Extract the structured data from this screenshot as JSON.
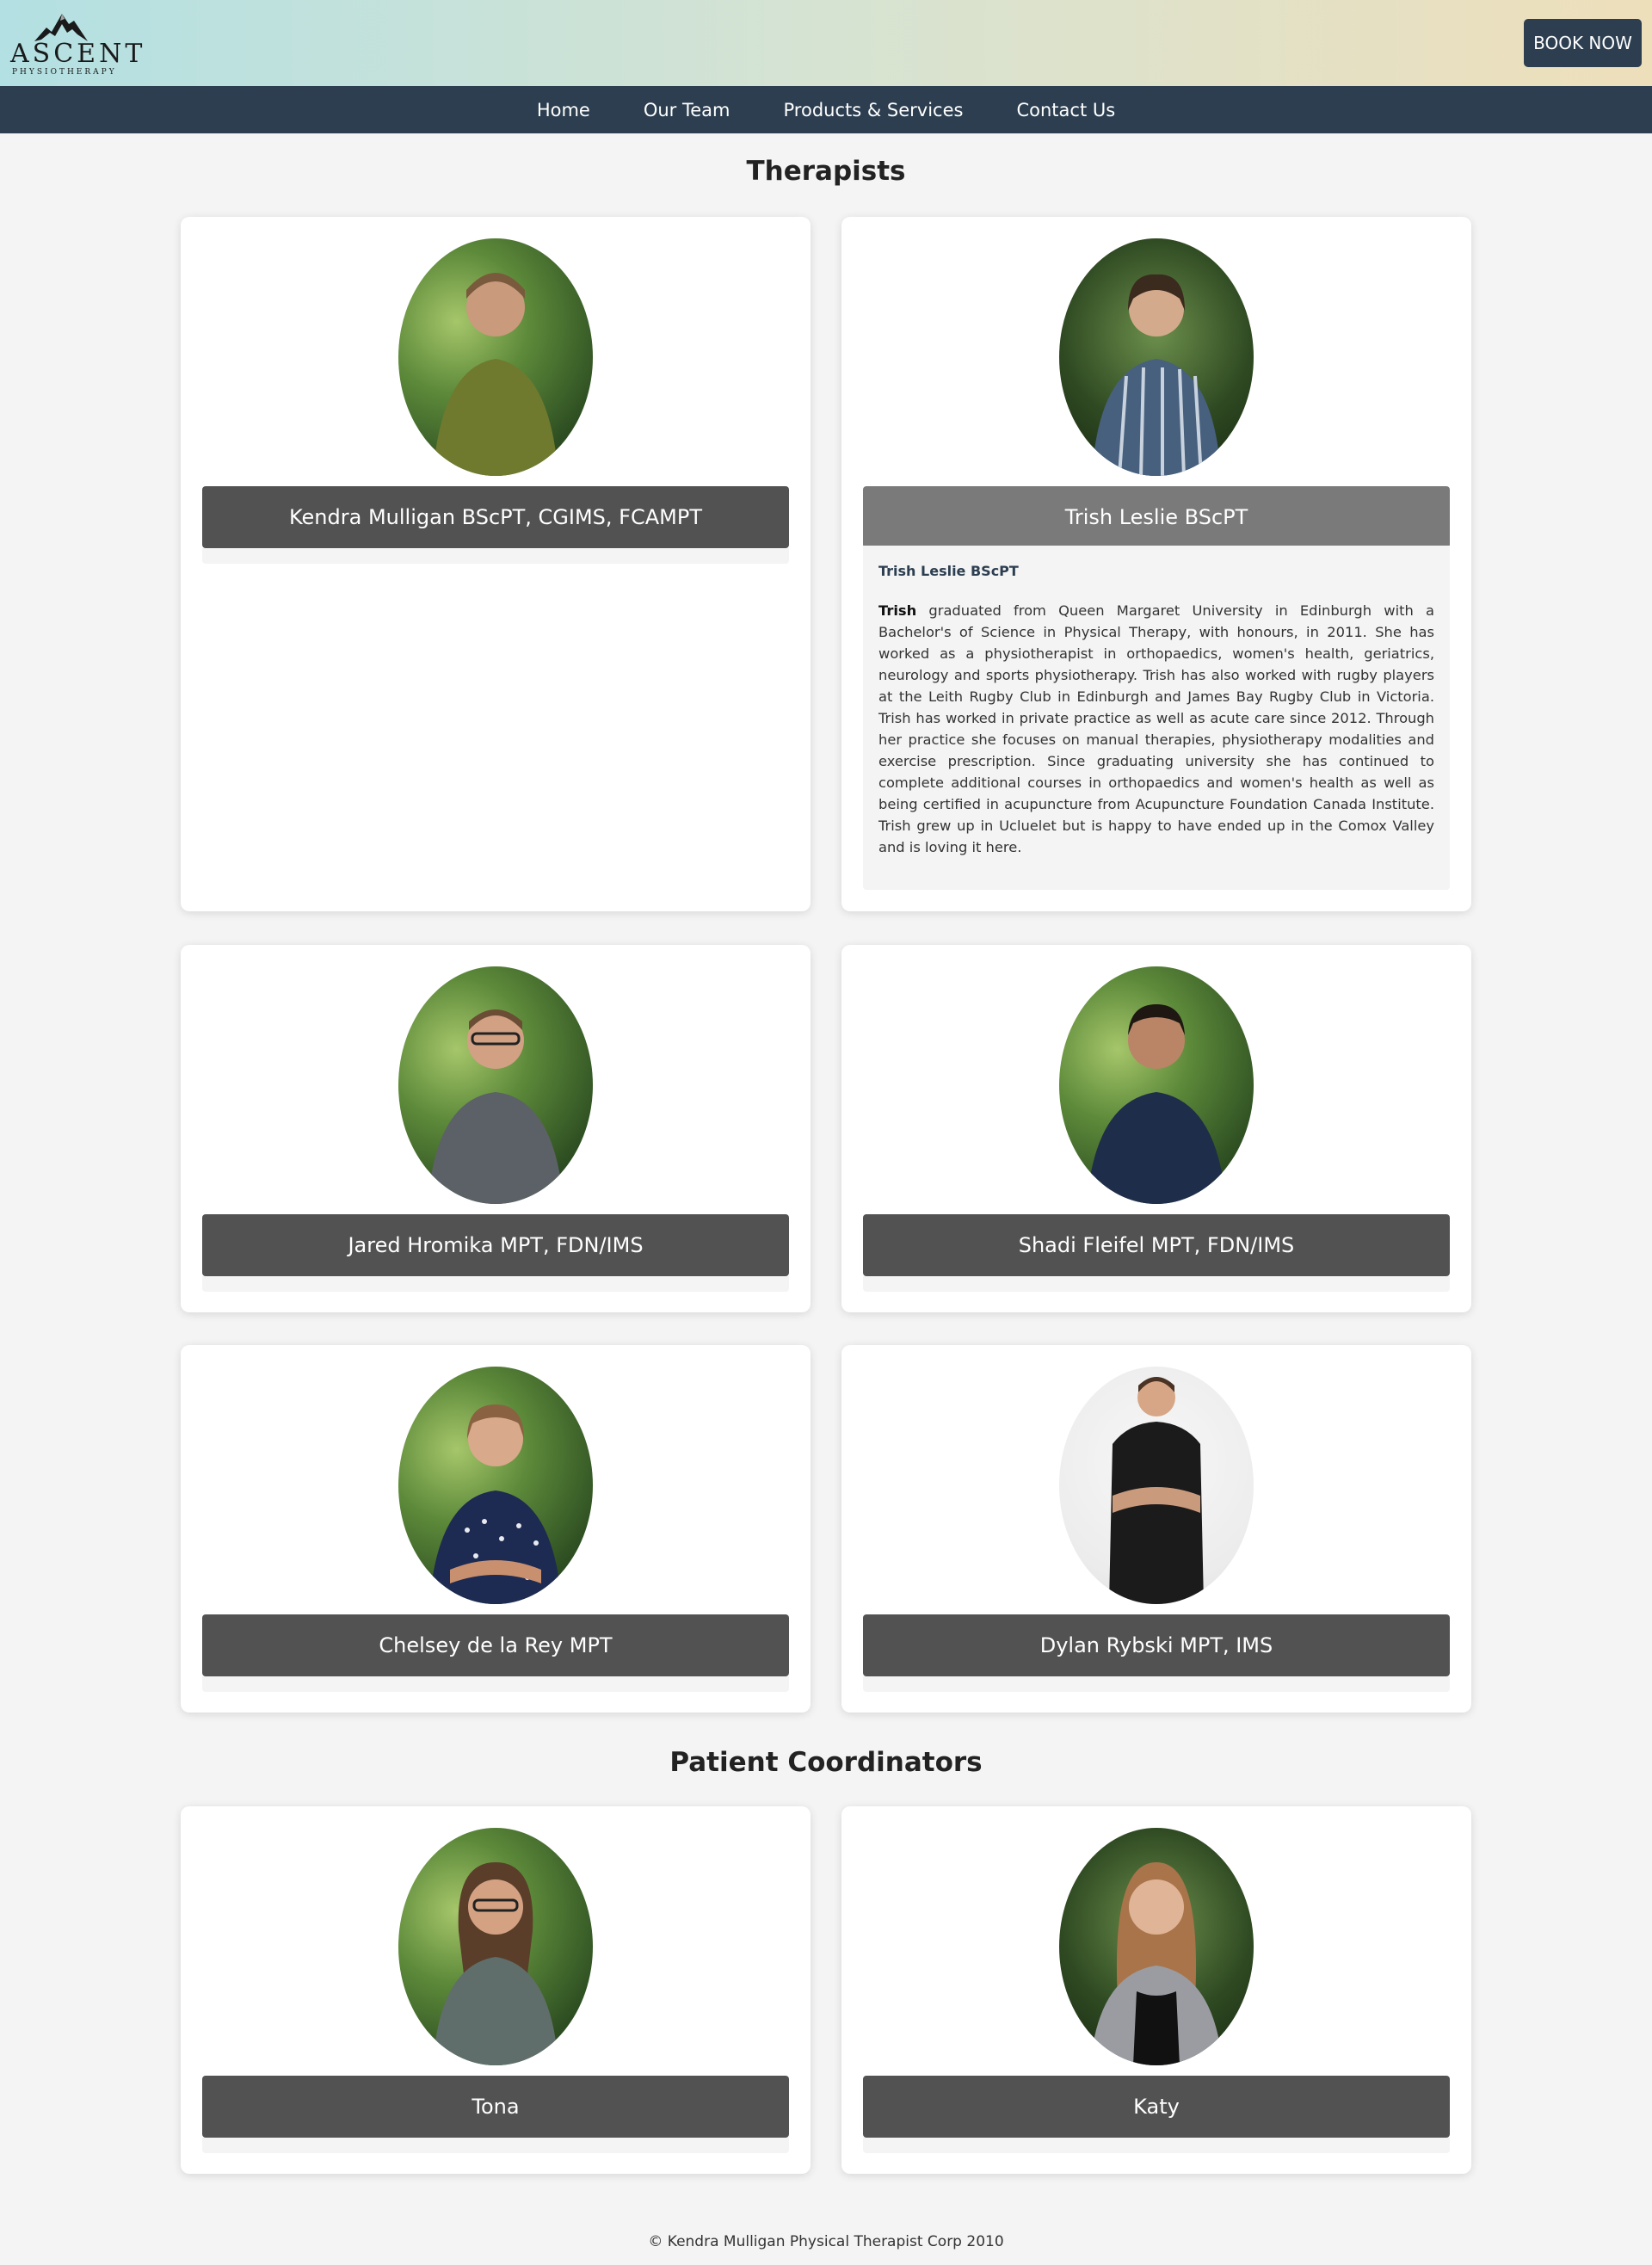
{
  "header": {
    "logo_text": "ASCENT",
    "logo_subtext": "PHYSIOTHERAPY",
    "book_button": "BOOK NOW"
  },
  "nav": {
    "items": [
      "Home",
      "Our Team",
      "Products & Services",
      "Contact Us"
    ]
  },
  "therapists": {
    "title": "Therapists",
    "members": [
      {
        "name": "Kendra Mulligan BScPT, CGIMS, FCAMPT"
      },
      {
        "name": "Trish Leslie BScPT",
        "bio_title": "Trish Leslie BScPT",
        "bio_first_word": "Trish",
        "bio_body": " graduated from Queen Margaret University in Edinburgh with a Bachelor's of Science in Physical Therapy, with honours, in 2011. She has worked as a physiotherapist in orthopaedics, women's health, geriatrics, neurology and sports physiotherapy. Trish has also worked with rugby players at the Leith Rugby Club in Edinburgh and James Bay Rugby Club in Victoria. Trish has worked in private practice as well as acute care since 2012. Through her practice she focuses on manual therapies, physiotherapy modalities and exercise prescription. Since graduating university she has continued to complete additional courses in orthopaedics and women's health as well as being certified in acupuncture from Acupuncture Foundation Canada Institute. Trish grew up in Ucluelet but is happy to have ended up in the Comox Valley and is loving it here."
      },
      {
        "name": "Jared Hromika MPT, FDN/IMS"
      },
      {
        "name": "Shadi Fleifel MPT, FDN/IMS"
      },
      {
        "name": "Chelsey de la Rey MPT"
      },
      {
        "name": "Dylan Rybski MPT, IMS"
      }
    ]
  },
  "coordinators": {
    "title": "Patient Coordinators",
    "members": [
      {
        "name": "Tona"
      },
      {
        "name": "Katy"
      }
    ]
  },
  "footer": {
    "text": "© Kendra Mulligan Physical Therapist Corp 2010"
  }
}
